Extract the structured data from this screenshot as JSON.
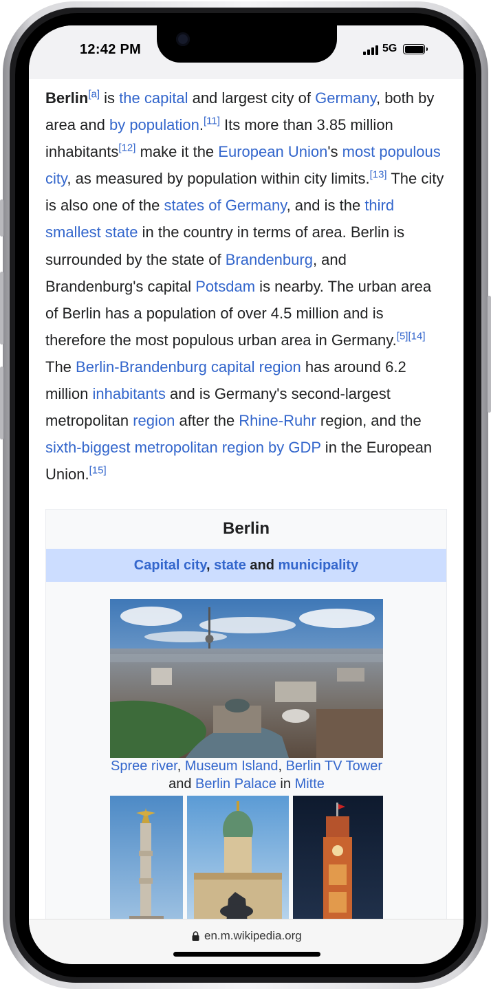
{
  "status_bar": {
    "time": "12:42 PM",
    "network": "5G"
  },
  "article": {
    "segments": [
      {
        "t": "Berlin",
        "style": "bold"
      },
      {
        "t": "[a]",
        "style": "sup"
      },
      {
        "t": " is "
      },
      {
        "t": "the capital",
        "style": "link"
      },
      {
        "t": " and largest city of "
      },
      {
        "t": "Germany",
        "style": "link"
      },
      {
        "t": ", both by area and "
      },
      {
        "t": "by population",
        "style": "link"
      },
      {
        "t": "."
      },
      {
        "t": "[11]",
        "style": "sup"
      },
      {
        "t": " Its more than 3.85 million inhabitants"
      },
      {
        "t": "[12]",
        "style": "sup"
      },
      {
        "t": " make it the "
      },
      {
        "t": "European Union",
        "style": "link"
      },
      {
        "t": "'s "
      },
      {
        "t": "most populous city",
        "style": "link"
      },
      {
        "t": ", as measured by population within city limits."
      },
      {
        "t": "[13]",
        "style": "sup"
      },
      {
        "t": " The city is also one of the "
      },
      {
        "t": "states of Germany",
        "style": "link"
      },
      {
        "t": ", and is the "
      },
      {
        "t": "third smallest state",
        "style": "link"
      },
      {
        "t": " in the country in terms of area. Berlin is surrounded by the state of "
      },
      {
        "t": "Brandenburg",
        "style": "link"
      },
      {
        "t": ", and Brandenburg's capital "
      },
      {
        "t": "Potsdam",
        "style": "link"
      },
      {
        "t": " is nearby. The urban area of Berlin has a population of over 4.5 million and is therefore the most populous urban area in Germany."
      },
      {
        "t": "[5]",
        "style": "sup"
      },
      {
        "t": "[14]",
        "style": "sup"
      },
      {
        "t": " The "
      },
      {
        "t": "Berlin-Brandenburg capital region",
        "style": "link"
      },
      {
        "t": " has around 6.2 million "
      },
      {
        "t": "inhabitants",
        "style": "link"
      },
      {
        "t": " and is Germany's second-largest metropolitan "
      },
      {
        "t": "region",
        "style": "link"
      },
      {
        "t": " after the "
      },
      {
        "t": "Rhine-Ruhr",
        "style": "link"
      },
      {
        "t": " region, and the "
      },
      {
        "t": "sixth-biggest metropolitan region by GDP",
        "style": "link"
      },
      {
        "t": " in the European Union."
      },
      {
        "t": "[15]",
        "style": "sup"
      }
    ]
  },
  "infobox": {
    "title": "Berlin",
    "subtitle": {
      "link1": "Capital city",
      "sep1": ", ",
      "link2": "state",
      "sep2": " and ",
      "link3": "municipality"
    },
    "caption": {
      "l1": "Spree river",
      "s1": ", ",
      "l2": "Museum Island",
      "s2": ", ",
      "l3": "Berlin TV Tower",
      "s3": " and ",
      "l4": "Berlin Palace",
      "s4": " in ",
      "l5": "Mitte"
    }
  },
  "url_bar": {
    "url": "en.m.wikipedia.org"
  },
  "colors": {
    "link": "#3366cc",
    "text": "#202122",
    "infobox_sub_bg": "#ccddff"
  },
  "icons": [
    "lock-icon",
    "signal-icon",
    "battery-icon"
  ]
}
